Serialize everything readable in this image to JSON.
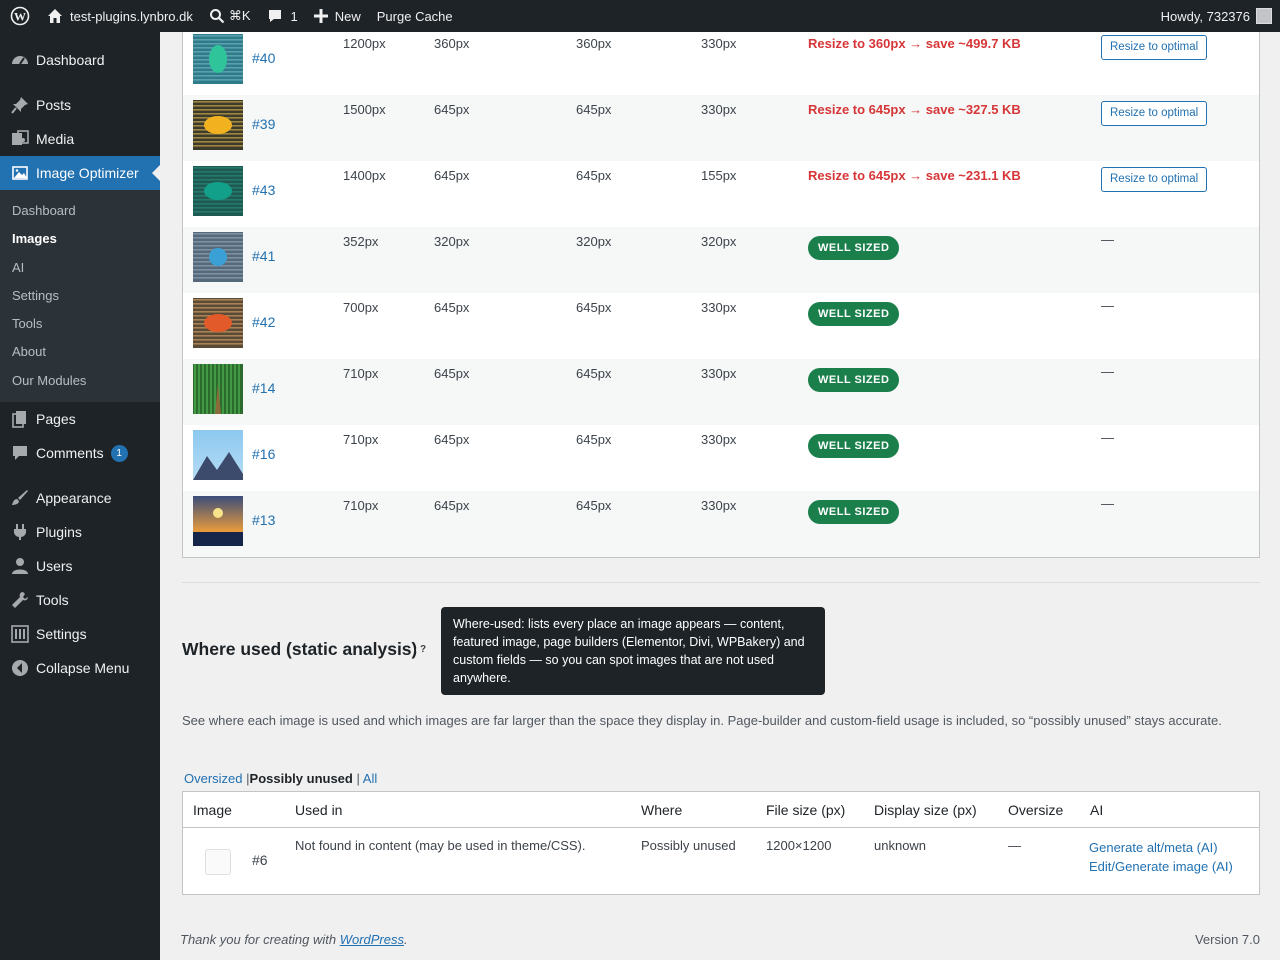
{
  "adminbar": {
    "site": "test-plugins.lynbro.dk",
    "search_shortcut": "⌘K",
    "comments_count": "1",
    "new_label": "New",
    "purge_label": "Purge Cache",
    "howdy": "Howdy, 732376"
  },
  "sidebar": {
    "items": [
      {
        "label": "Dashboard",
        "icon": "dashboard-icon"
      },
      {
        "label": "Posts",
        "icon": "pin-icon"
      },
      {
        "label": "Media",
        "icon": "media-icon"
      },
      {
        "label": "Image Optimizer",
        "icon": "image-icon"
      },
      {
        "label": "Pages",
        "icon": "pages-icon"
      },
      {
        "label": "Comments",
        "icon": "comment-icon",
        "badge": "1"
      },
      {
        "label": "Appearance",
        "icon": "brush-icon"
      },
      {
        "label": "Plugins",
        "icon": "plugin-icon"
      },
      {
        "label": "Users",
        "icon": "user-icon"
      },
      {
        "label": "Tools",
        "icon": "wrench-icon"
      },
      {
        "label": "Settings",
        "icon": "sliders-icon"
      },
      {
        "label": "Collapse Menu",
        "icon": "collapse-icon"
      }
    ],
    "submenu": [
      "Dashboard",
      "Images",
      "AI",
      "Settings",
      "Tools",
      "About",
      "Our Modules"
    ],
    "active_submenu": "Images"
  },
  "image_rows": [
    {
      "id": "#40",
      "original": "1200px",
      "largest": "360px",
      "content": "360px",
      "min": "330px",
      "recommendation": "Resize to 360px → save ~499.7 KB",
      "status": "oversized",
      "action": "Resize to optimal",
      "thumb_bg": "#2e7b8c",
      "thumb_stripe": "#6fb0b8",
      "thumb_shape": "#2fc49a"
    },
    {
      "id": "#39",
      "original": "1500px",
      "largest": "645px",
      "content": "645px",
      "min": "330px",
      "recommendation": "Resize to 645px → save ~327.5 KB",
      "status": "oversized",
      "action": "Resize to optimal",
      "thumb_bg": "#3d3b2c",
      "thumb_stripe": "#c9a84a",
      "thumb_shape": "#f2b21f"
    },
    {
      "id": "#43",
      "original": "1400px",
      "largest": "645px",
      "content": "645px",
      "min": "155px",
      "recommendation": "Resize to 645px → save ~231.1 KB",
      "status": "oversized",
      "action": "Resize to optimal",
      "thumb_bg": "#1d5a52",
      "thumb_stripe": "#2f8478",
      "thumb_shape": "#13a08a"
    },
    {
      "id": "#41",
      "original": "352px",
      "largest": "320px",
      "content": "320px",
      "min": "320px",
      "recommendation": "WELL SIZED",
      "status": "well",
      "action": "—",
      "thumb_bg": "#56697a",
      "thumb_stripe": "#8fa3b3",
      "thumb_shape": "#3aa0d6"
    },
    {
      "id": "#42",
      "original": "700px",
      "largest": "645px",
      "content": "645px",
      "min": "330px",
      "recommendation": "WELL SIZED",
      "status": "well",
      "action": "—",
      "thumb_bg": "#5b4a35",
      "thumb_stripe": "#c79b66",
      "thumb_shape": "#e35a2a"
    },
    {
      "id": "#14",
      "original": "710px",
      "largest": "645px",
      "content": "645px",
      "min": "330px",
      "recommendation": "WELL SIZED",
      "status": "well",
      "action": "—",
      "thumb_bg": "#2d6a2d",
      "thumb_stripe": "#4caf50",
      "thumb_shape": "#8b6b3a"
    },
    {
      "id": "#16",
      "original": "710px",
      "largest": "645px",
      "content": "645px",
      "min": "330px",
      "recommendation": "WELL SIZED",
      "status": "well",
      "action": "—",
      "thumb_bg": "#8cc8ef",
      "thumb_stripe": "#b5dcf5",
      "thumb_shape": "#3c4a6b"
    },
    {
      "id": "#13",
      "original": "710px",
      "largest": "645px",
      "content": "645px",
      "min": "330px",
      "recommendation": "WELL SIZED",
      "status": "well",
      "action": "—",
      "thumb_bg": "#3a4d7a",
      "thumb_stripe": "#e69a3d",
      "thumb_shape": "#f7e38a"
    }
  ],
  "where_used": {
    "title": "Where used (static analysis)",
    "help": "?",
    "tooltip": "Where-used: lists every place an image appears — content, featured image, page builders (Elementor, Divi, WPBakery) and custom fields — so you can spot images that are not used anywhere.",
    "description": "See where each image is used and which images are far larger than the space they display in. Page-builder and custom-field usage is included, so “possibly unused” stays accurate.",
    "filters": {
      "oversized": "Oversized",
      "possibly_unused": "Possibly unused",
      "all": "All",
      "sep1": "|",
      "sep2": "|"
    },
    "columns": {
      "image": "Image",
      "used_in": "Used in",
      "where": "Where",
      "file_size": "File size (px)",
      "display_size": "Display size (px)",
      "oversize": "Oversize",
      "ai": "AI"
    },
    "row": {
      "id": "#6",
      "used_in": "Not found in content (may be used in theme/CSS).",
      "where": "Possibly unused",
      "file_size": "1200×1200",
      "display_size": "unknown",
      "oversize": "—",
      "ai_alt": "Generate alt/meta (AI)",
      "ai_edit": "Edit/Generate image (AI)"
    }
  },
  "footer": {
    "thanks_prefix": "Thank you for creating with",
    "thanks_link": "WordPress",
    "thanks_suffix": ".",
    "version": "Version 7.0"
  },
  "colors": {
    "adminbar": "#1d2327",
    "accent": "#2271b1",
    "danger": "#d63638",
    "success_badge": "#1a7f4b"
  }
}
